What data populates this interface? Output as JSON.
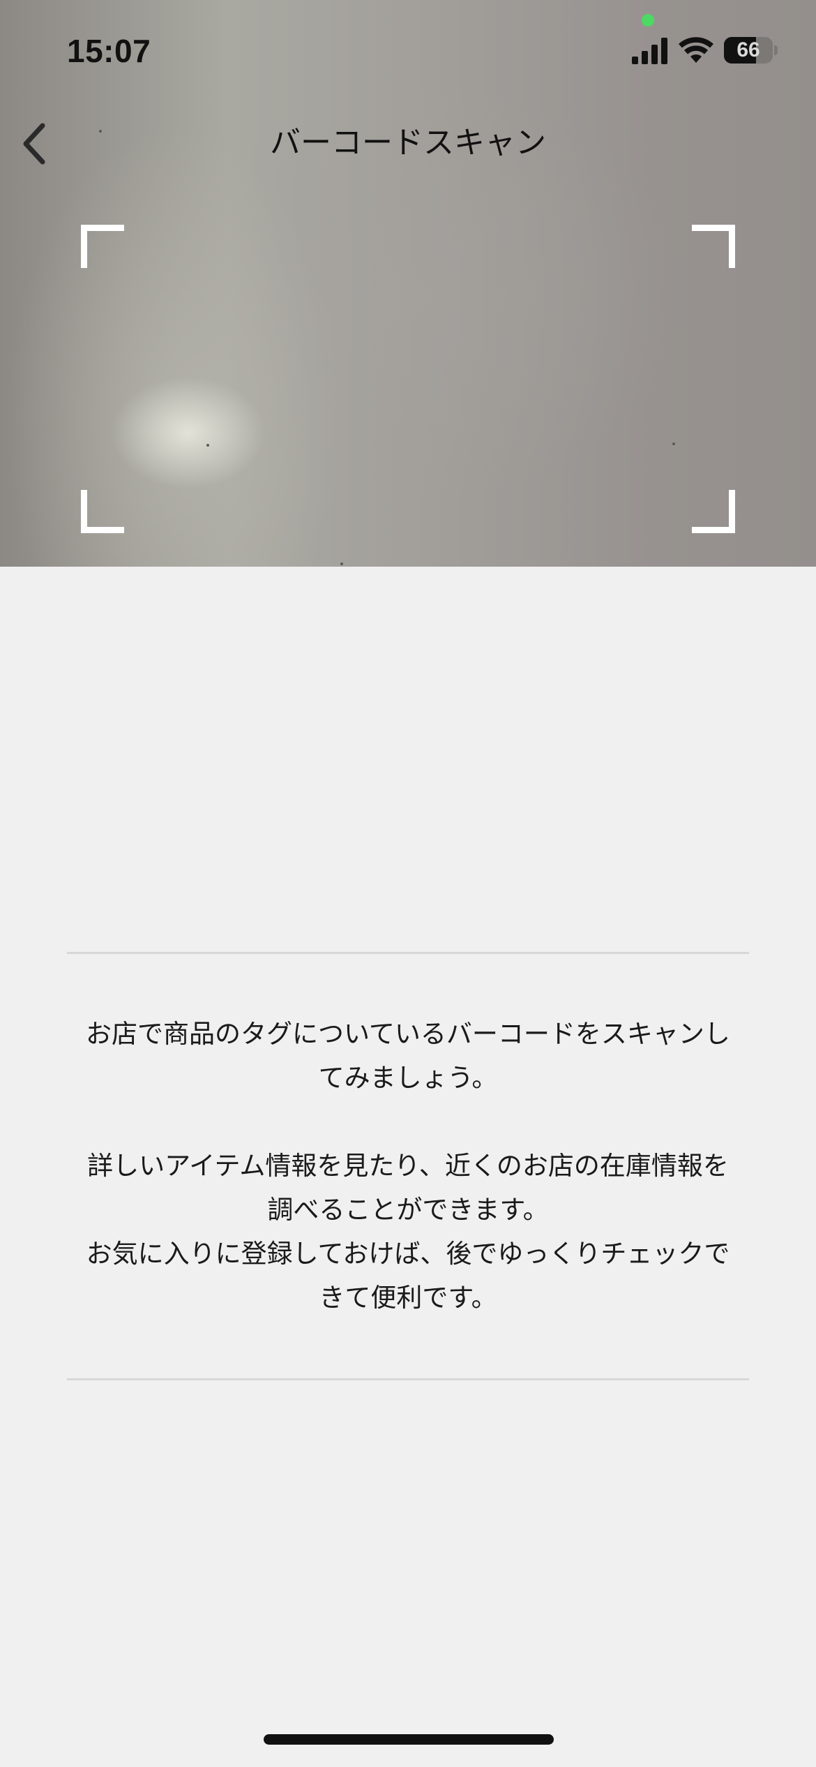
{
  "status_bar": {
    "time": "15:07",
    "battery_level": "66",
    "battery_fraction": 0.66,
    "privacy_indicator_color": "#4cd964",
    "icons": [
      "cellular-signal-icon",
      "wifi-icon",
      "battery-icon"
    ]
  },
  "header": {
    "title": "バーコードスキャン",
    "back_icon": "chevron-left-icon"
  },
  "scanner": {
    "frame_icon": "scan-frame-corners",
    "frame_color": "#ffffff"
  },
  "info": {
    "paragraph1": "お店で商品のタグについているバーコードをスキャンし\nてみましょう。",
    "paragraph2": "詳しいアイテム情報を見たり、近くのお店の在庫情報を\n調べることができます。\nお気に入りに登録しておけば、後でゆっくりチェックで\nきて便利です。"
  },
  "colors": {
    "background": "#f0f0f0",
    "text": "#1a1a1a",
    "divider": "#d7d7d7"
  }
}
